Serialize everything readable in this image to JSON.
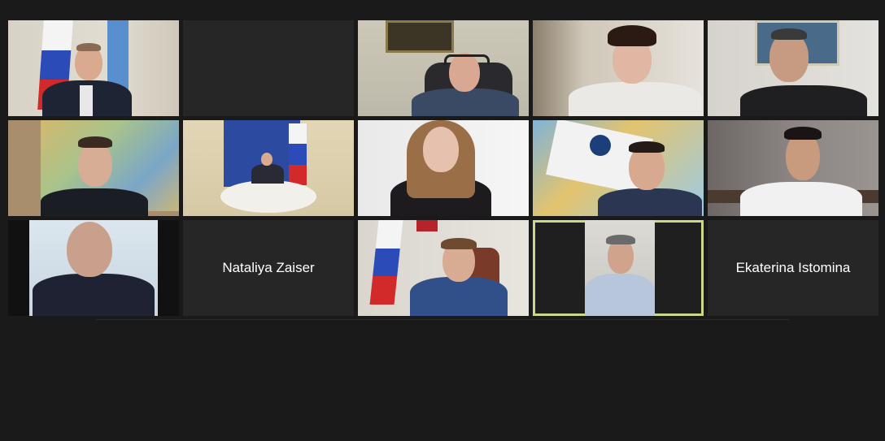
{
  "participants": [
    {
      "id": "p1",
      "name": "",
      "video": true
    },
    {
      "id": "p2",
      "name": "",
      "video": false
    },
    {
      "id": "p3",
      "name": "",
      "video": true
    },
    {
      "id": "p4",
      "name": "",
      "video": true
    },
    {
      "id": "p5",
      "name": "",
      "video": true
    },
    {
      "id": "p6",
      "name": "",
      "video": true
    },
    {
      "id": "p7",
      "name": "",
      "video": true
    },
    {
      "id": "p8",
      "name": "",
      "video": true
    },
    {
      "id": "p9",
      "name": "",
      "video": true
    },
    {
      "id": "p10",
      "name": "",
      "video": true
    },
    {
      "id": "p11",
      "name": "",
      "video": true
    },
    {
      "id": "p12",
      "name": "Nataliya Zaiser",
      "video": false
    },
    {
      "id": "p13",
      "name": "",
      "video": true
    },
    {
      "id": "p14",
      "name": "",
      "video": true,
      "active_speaker": true
    },
    {
      "id": "p15",
      "name": "Ekaterina Istomina",
      "video": false
    }
  ],
  "colors": {
    "background": "#1a1a1a",
    "tile_empty": "#262626",
    "active_speaker_border": "#c9d98a",
    "name_text": "#ffffff"
  },
  "icons": [
    "russian-flag-icon"
  ]
}
